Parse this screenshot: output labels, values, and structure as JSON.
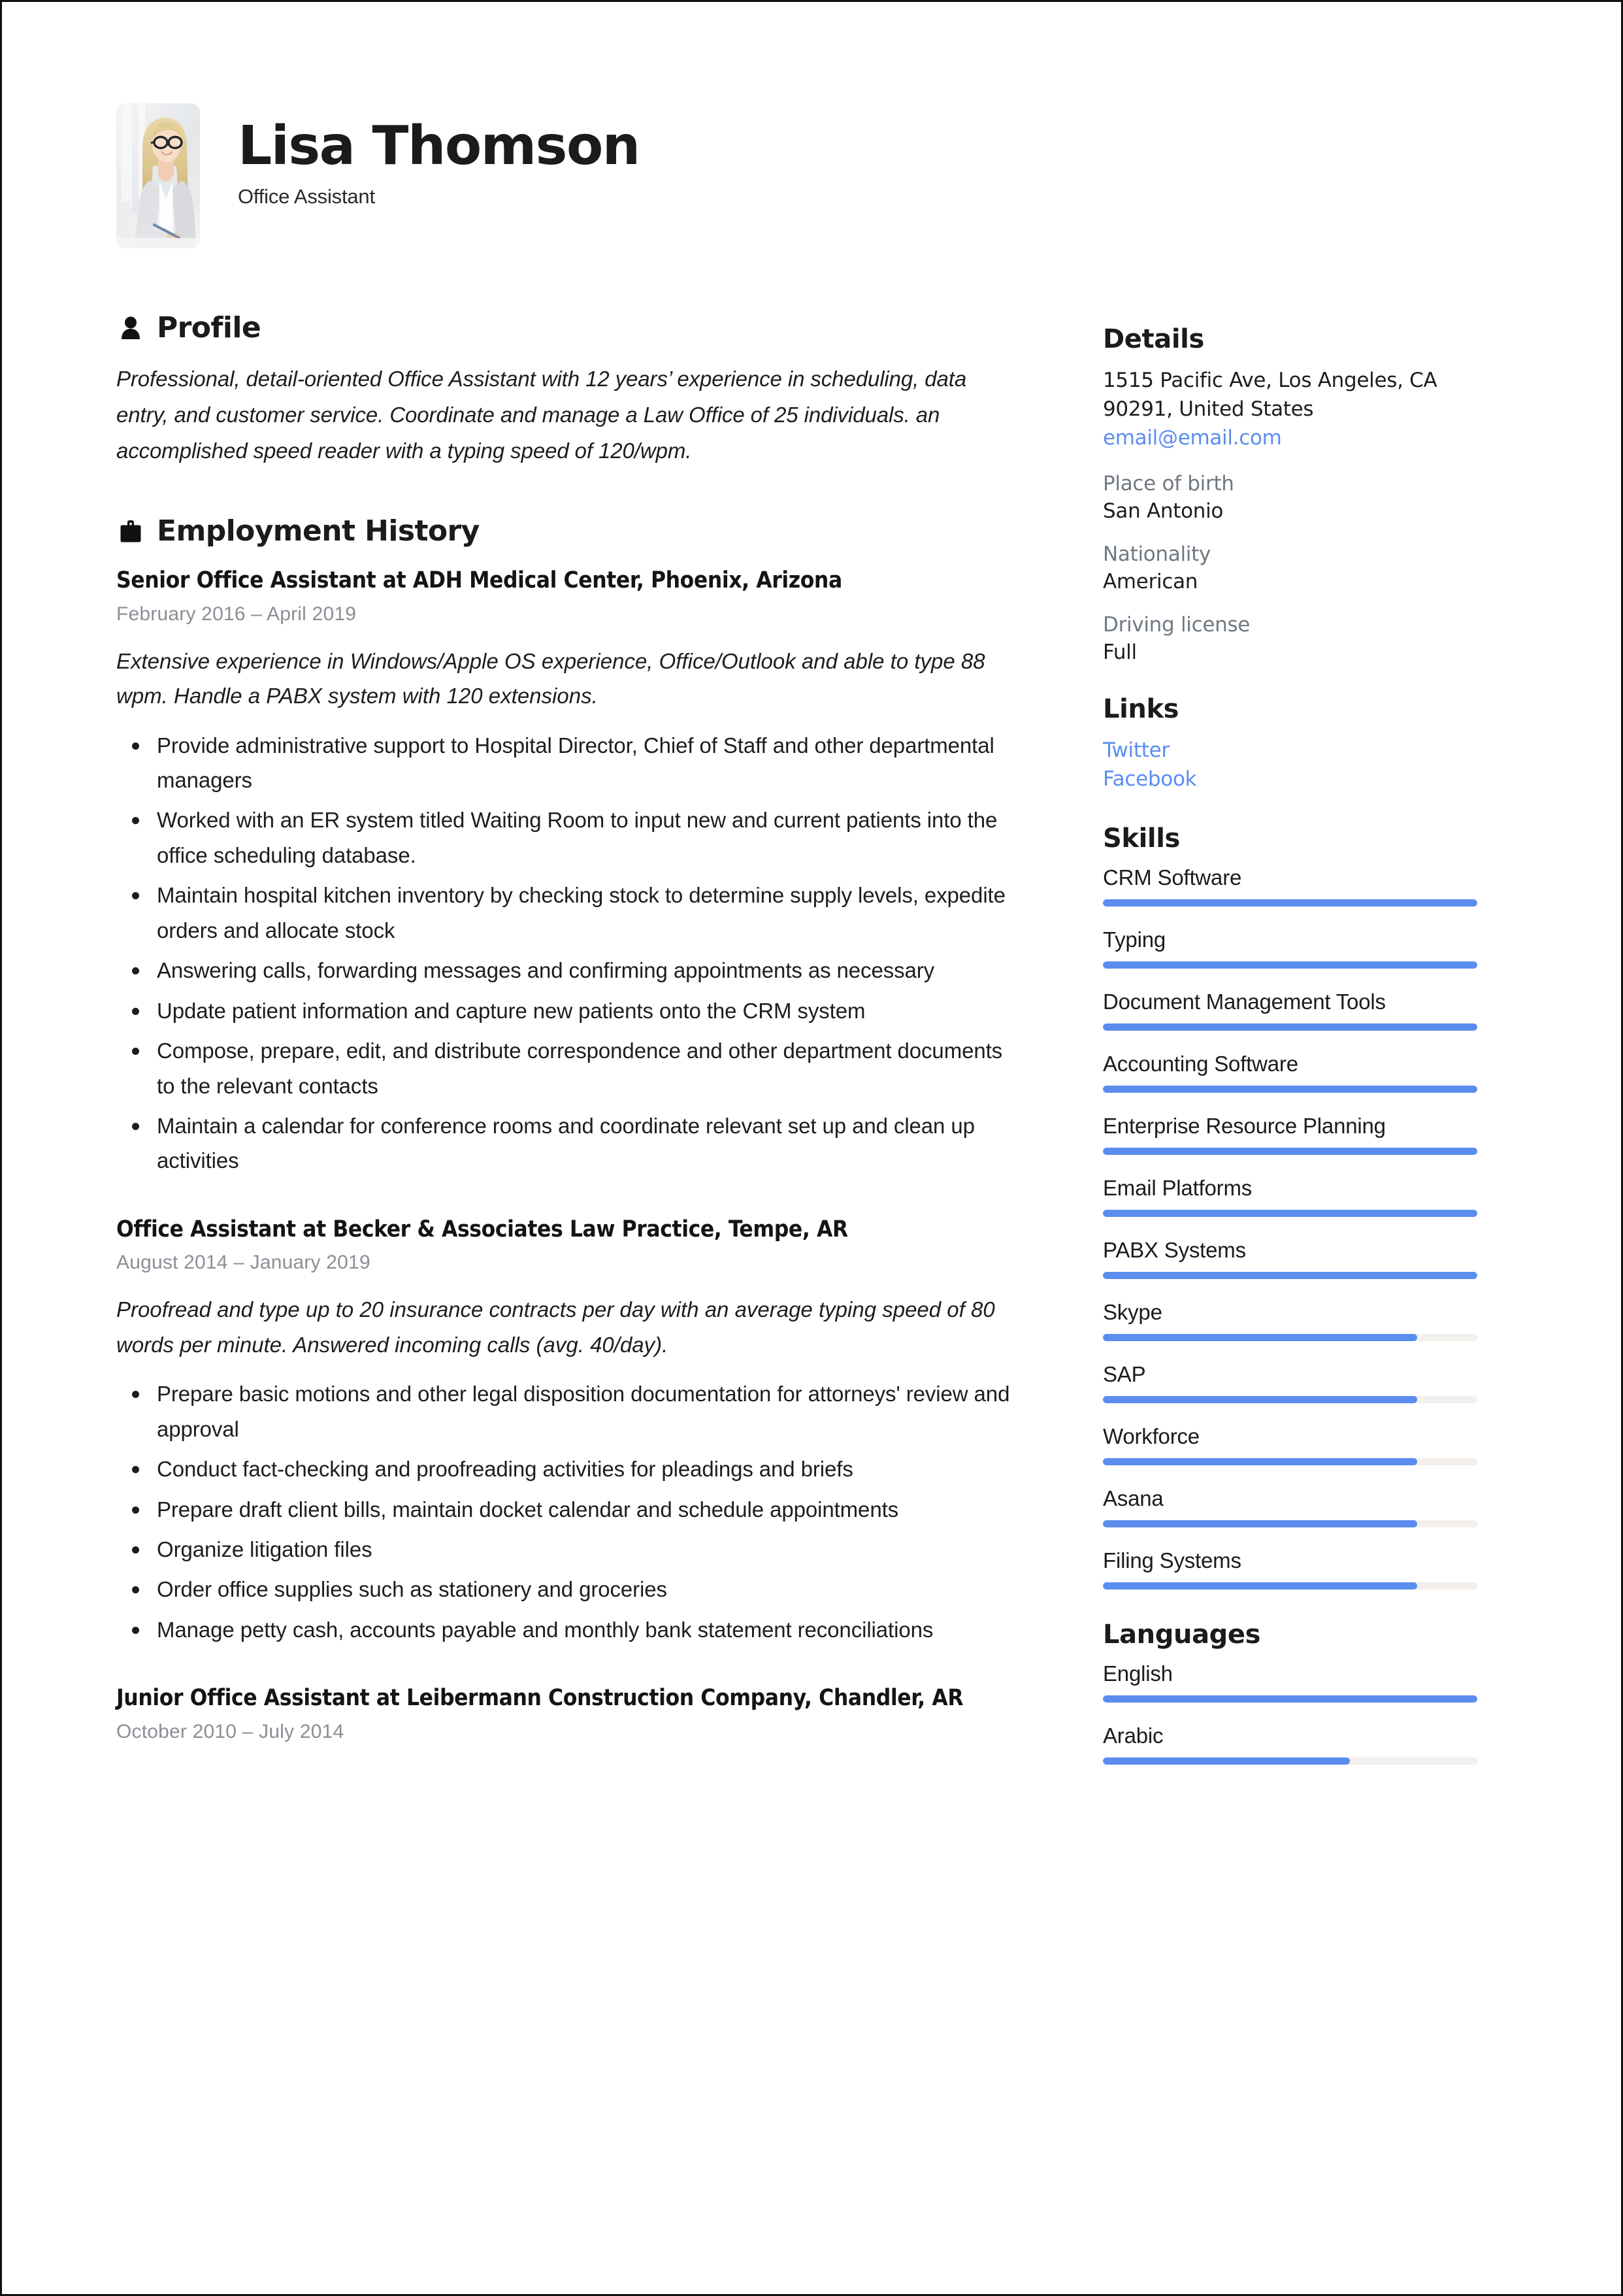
{
  "header": {
    "name": "Lisa Thomson",
    "job_title": "Office Assistant",
    "avatar_alt": "profile-photo"
  },
  "accent_color": "#5b8def",
  "link_color": "#5b8def",
  "profile": {
    "heading": "Profile",
    "icon": "person-icon",
    "text": "Professional, detail-oriented Office Assistant with 12 years’ experience in scheduling, data entry, and customer service. Coordinate and manage a Law Office of 25 individuals. an accomplished speed reader with a typing speed of 120/wpm."
  },
  "employment": {
    "heading": "Employment History",
    "icon": "briefcase-icon",
    "jobs": [
      {
        "title": "Senior Office Assistant at ADH Medical Center, Phoenix, Arizona",
        "dates": "February 2016  –  April 2019",
        "description": "Extensive experience in Windows/Apple OS experience, Office/Outlook and able to type 88 wpm. Handle a PABX system with 120 extensions.",
        "bullets": [
          "Provide administrative support to Hospital Director, Chief of Staff and other departmental managers",
          "Worked with an ER system titled Waiting Room to input new and current patients into the office scheduling database.",
          "Maintain hospital kitchen inventory by checking stock to determine supply levels, expedite orders and allocate stock",
          "Answering calls, forwarding messages and confirming appointments as necessary",
          "Update patient information and capture new patients onto the CRM system",
          "Compose, prepare, edit, and distribute correspondence and other department documents to the relevant contacts",
          "Maintain a calendar for conference rooms and coordinate relevant set up and clean up activities"
        ]
      },
      {
        "title": "Office Assistant at Becker & Associates Law Practice, Tempe, AR",
        "dates": "August 2014  –  January 2019",
        "description": "Proofread and type up to 20 insurance contracts per day with an average typing speed of 80 words per minute. Answered incoming calls (avg. 40/day).",
        "bullets": [
          "Prepare basic motions and other legal disposition documentation for attorneys' review and approval",
          "Conduct fact-checking and proofreading activities for pleadings and briefs",
          "Prepare draft client bills, maintain docket calendar and schedule appointments",
          "Organize litigation files",
          "Order office supplies such as stationery and groceries",
          "Manage petty cash, accounts payable and monthly bank statement reconciliations"
        ]
      },
      {
        "title": "Junior Office Assistant at Leibermann Construction Company, Chandler, AR",
        "dates": "October 2010  –  July 2014",
        "description": "",
        "bullets": []
      }
    ]
  },
  "details": {
    "heading": "Details",
    "address_line1": "1515 Pacific Ave, Los Angeles, CA",
    "address_line2": "90291, United States",
    "email": "email@email.com",
    "fields": [
      {
        "label": "Place of birth",
        "value": "San Antonio"
      },
      {
        "label": "Nationality",
        "value": "American"
      },
      {
        "label": "Driving license",
        "value": "Full"
      }
    ]
  },
  "links": {
    "heading": "Links",
    "items": [
      {
        "label": "Twitter"
      },
      {
        "label": "Facebook"
      }
    ]
  },
  "skills": {
    "heading": "Skills",
    "items": [
      {
        "name": "CRM Software",
        "level": 100
      },
      {
        "name": "Typing",
        "level": 100
      },
      {
        "name": "Document Management Tools",
        "level": 100
      },
      {
        "name": "Accounting Software",
        "level": 100
      },
      {
        "name": "Enterprise Resource Planning",
        "level": 100
      },
      {
        "name": "Email Platforms",
        "level": 100
      },
      {
        "name": "PABX Systems",
        "level": 100
      },
      {
        "name": "Skype",
        "level": 84
      },
      {
        "name": "SAP",
        "level": 84
      },
      {
        "name": "Workforce",
        "level": 84
      },
      {
        "name": "Asana",
        "level": 84
      },
      {
        "name": "Filing Systems",
        "level": 84
      }
    ]
  },
  "languages": {
    "heading": "Languages",
    "items": [
      {
        "name": "English",
        "level": 100
      },
      {
        "name": "Arabic",
        "level": 66
      }
    ]
  }
}
